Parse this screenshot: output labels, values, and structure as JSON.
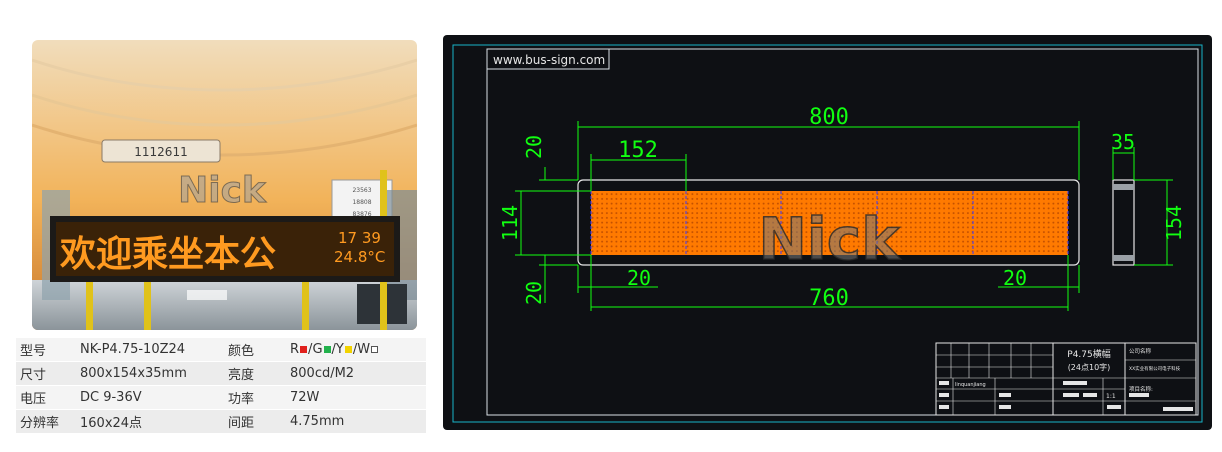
{
  "photo": {
    "logo_text": "Nick",
    "sign_text": "欢迎乘坐本公",
    "time": "17 39",
    "temp": "24.8°C",
    "ceiling_sign_text": "1112611",
    "notice_lines": [
      "23563",
      "18808",
      "83876"
    ]
  },
  "specs": {
    "rows": [
      {
        "label1": "型号",
        "value1": "NK-P4.75-10Z24",
        "label2": "颜色",
        "value2": "color"
      },
      {
        "label1": "尺寸",
        "value1": "800x154x35mm",
        "label2": "亮度",
        "value2": "800cd/M2"
      },
      {
        "label1": "电压",
        "value1": "DC 9-36V",
        "label2": "功率",
        "value2": "72W"
      },
      {
        "label1": "分辨率",
        "value1": "160x24点",
        "label2": "间距",
        "value2": "4.75mm"
      }
    ],
    "colors": [
      {
        "letter": "R",
        "hex": "#e0201c"
      },
      {
        "letter": "G",
        "hex": "#22b14c"
      },
      {
        "letter": "Y",
        "hex": "#f2d300"
      },
      {
        "letter": "W",
        "hex": "#ffffff"
      }
    ]
  },
  "drawing": {
    "url": "www.bus-sign.com",
    "logo_text": "Nick",
    "dims": {
      "total_width": "800",
      "module_width": "152",
      "top_margin": "20",
      "panel_height": "114",
      "bottom_margin": "20",
      "left_margin": "20",
      "right_margin": "20",
      "display_width": "760",
      "depth": "35",
      "total_height": "154"
    },
    "title_block": {
      "title": "P4.75横幅",
      "subtitle": "(24点10字)",
      "company_label": "公司名称",
      "company_name": "XX实业有限公司电子科技",
      "project_label": "项目名称:",
      "designer": "linquanjiang",
      "scale": "1:1"
    },
    "colors": {
      "background": "#0e1014",
      "border": "#d9e1e6",
      "dimension": "#11ff11",
      "led": "#ff7a00",
      "outline": "#e6e6e6"
    }
  }
}
